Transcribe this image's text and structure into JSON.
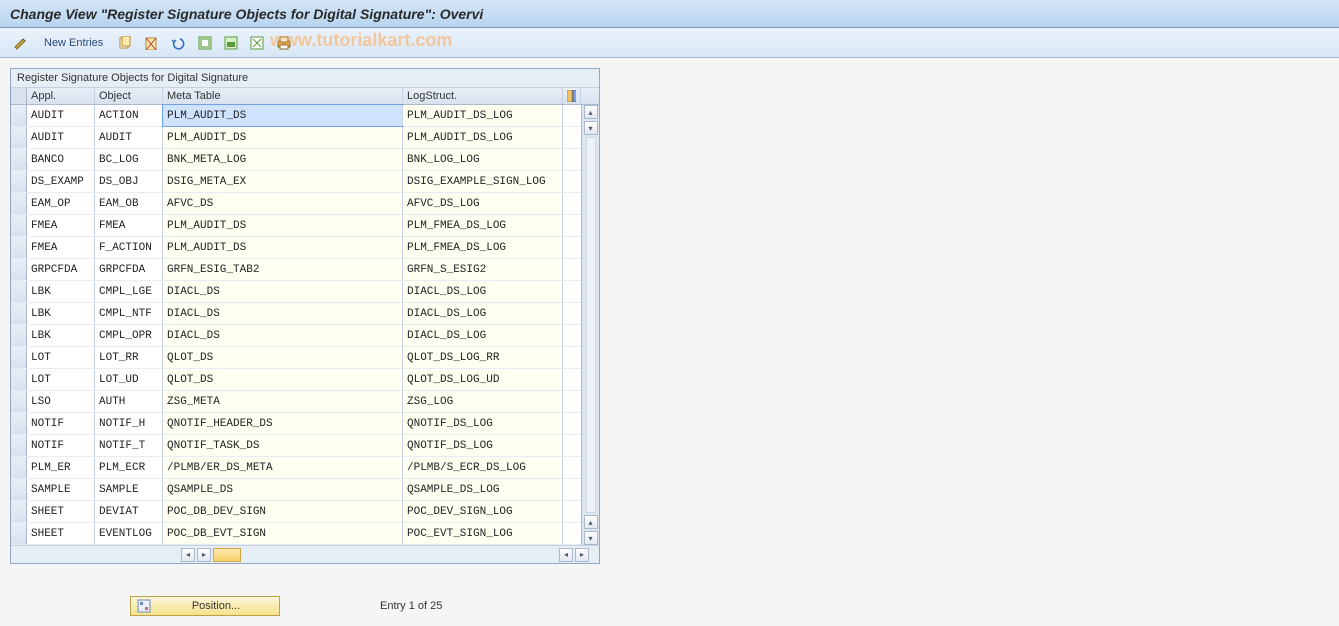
{
  "header": {
    "title": "Change View \"Register Signature Objects for Digital Signature\": Overvi"
  },
  "toolbar": {
    "new_entries": "New Entries"
  },
  "watermark": "www.tutorialkart.com",
  "grid": {
    "title": "Register Signature Objects for Digital Signature",
    "columns": {
      "appl": "Appl.",
      "object": "Object",
      "meta": "Meta Table",
      "log": "LogStruct."
    },
    "rows": [
      {
        "appl": "AUDIT",
        "obj": "ACTION",
        "meta": "PLM_AUDIT_DS",
        "log": "PLM_AUDIT_DS_LOG"
      },
      {
        "appl": "AUDIT",
        "obj": "AUDIT",
        "meta": "PLM_AUDIT_DS",
        "log": "PLM_AUDIT_DS_LOG"
      },
      {
        "appl": "BANCO",
        "obj": "BC_LOG",
        "meta": "BNK_META_LOG",
        "log": "BNK_LOG_LOG"
      },
      {
        "appl": "DS_EXAMP",
        "obj": "DS_OBJ",
        "meta": "DSIG_META_EX",
        "log": "DSIG_EXAMPLE_SIGN_LOG"
      },
      {
        "appl": "EAM_OP",
        "obj": "EAM_OB",
        "meta": "AFVC_DS",
        "log": "AFVC_DS_LOG"
      },
      {
        "appl": "FMEA",
        "obj": "FMEA",
        "meta": "PLM_AUDIT_DS",
        "log": "PLM_FMEA_DS_LOG"
      },
      {
        "appl": "FMEA",
        "obj": "F_ACTION",
        "meta": "PLM_AUDIT_DS",
        "log": "PLM_FMEA_DS_LOG"
      },
      {
        "appl": "GRPCFDA",
        "obj": "GRPCFDA",
        "meta": "GRFN_ESIG_TAB2",
        "log": "GRFN_S_ESIG2"
      },
      {
        "appl": "LBK",
        "obj": "CMPL_LGE",
        "meta": "DIACL_DS",
        "log": "DIACL_DS_LOG"
      },
      {
        "appl": "LBK",
        "obj": "CMPL_NTF",
        "meta": "DIACL_DS",
        "log": "DIACL_DS_LOG"
      },
      {
        "appl": "LBK",
        "obj": "CMPL_OPR",
        "meta": "DIACL_DS",
        "log": "DIACL_DS_LOG"
      },
      {
        "appl": "LOT",
        "obj": "LOT_RR",
        "meta": "QLOT_DS",
        "log": "QLOT_DS_LOG_RR"
      },
      {
        "appl": "LOT",
        "obj": "LOT_UD",
        "meta": "QLOT_DS",
        "log": "QLOT_DS_LOG_UD"
      },
      {
        "appl": "LSO",
        "obj": "AUTH",
        "meta": "ZSG_META",
        "log": "ZSG_LOG"
      },
      {
        "appl": "NOTIF",
        "obj": "NOTIF_H",
        "meta": "QNOTIF_HEADER_DS",
        "log": "QNOTIF_DS_LOG"
      },
      {
        "appl": "NOTIF",
        "obj": "NOTIF_T",
        "meta": "QNOTIF_TASK_DS",
        "log": "QNOTIF_DS_LOG"
      },
      {
        "appl": "PLM_ER",
        "obj": "PLM_ECR",
        "meta": "/PLMB/ER_DS_META",
        "log": "/PLMB/S_ECR_DS_LOG"
      },
      {
        "appl": "SAMPLE",
        "obj": "SAMPLE",
        "meta": "QSAMPLE_DS",
        "log": "QSAMPLE_DS_LOG"
      },
      {
        "appl": "SHEET",
        "obj": "DEVIAT",
        "meta": "POC_DB_DEV_SIGN",
        "log": "POC_DEV_SIGN_LOG"
      },
      {
        "appl": "SHEET",
        "obj": "EVENTLOG",
        "meta": "POC_DB_EVT_SIGN",
        "log": "POC_EVT_SIGN_LOG"
      }
    ]
  },
  "footer": {
    "position_label": "Position...",
    "entry_label": "Entry 1 of 25"
  }
}
